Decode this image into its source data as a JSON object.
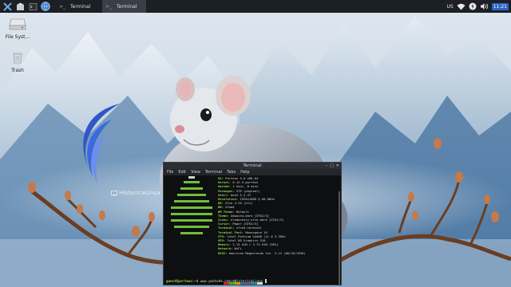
{
  "panel": {
    "tasks": [
      {
        "icon": "terminal-icon",
        "label": "Terminal"
      },
      {
        "icon": "terminal-icon",
        "label": "Terminal"
      }
    ],
    "tray": {
      "keyboard_layout": "US",
      "clock": "11:21"
    }
  },
  "desktop": {
    "icons": [
      {
        "label": "File Syst...",
        "icon": "drive-icon"
      },
      {
        "label": "Trash",
        "icon": "trash-icon"
      }
    ],
    "watermark": "HistoricaLinux"
  },
  "terminal": {
    "title": "Terminal",
    "menu": [
      "File",
      "Edit",
      "View",
      "Terminal",
      "Tabs",
      "Help"
    ],
    "info": [
      {
        "key": "OS:",
        "value": "Porteus 5.0 x86_64"
      },
      {
        "key": "Kernel:",
        "value": "6.12.5-porteus"
      },
      {
        "key": "Uptime:",
        "value": "1 hour, 8 mins"
      },
      {
        "key": "Packages:",
        "value": "576 (pkgtool)"
      },
      {
        "key": "Shell:",
        "value": "bash 5.2.37"
      },
      {
        "key": "Resolution:",
        "value": "1920x1080 @ 60.00Hz"
      },
      {
        "key": "DE:",
        "value": "Xfce 4.20 (x11)"
      },
      {
        "key": "WM:",
        "value": "Xfwm4"
      },
      {
        "key": "WM Theme:",
        "value": "Default"
      },
      {
        "key": "Theme:",
        "value": "Adwaita-dark [GTK2/3]"
      },
      {
        "key": "Icons:",
        "value": "elementary-xfce-dark [GTK2/3]"
      },
      {
        "key": "Cursor:",
        "value": "Paper [GTK2/3]"
      },
      {
        "key": "Terminal:",
        "value": "xfce4-terminal"
      },
      {
        "key": "Terminal Font:",
        "value": "Monospace 10"
      },
      {
        "key": "CPU:",
        "value": "Intel Pentium G4400 (2) @ 3.3GHz"
      },
      {
        "key": "GPU:",
        "value": "Intel HD Graphics 510"
      },
      {
        "key": "Memory:",
        "value": "2.13 GiB / 3.75 GiB (56%)"
      },
      {
        "key": "Network:",
        "value": "WiFi"
      },
      {
        "key": "BIOS:",
        "value": "American Megatrends Inc. 5.12 (06/26/2018)"
      }
    ],
    "prompt_user": "guest@porteus:~$",
    "prompt_text": "www.youtube.com/@HistoricaLinux"
  },
  "colors": {
    "panel_bg": "#1c1f24",
    "terminal_bg": "#0e0f11",
    "accent_green": "#8fd14f",
    "clock_bg": "#2a64c8"
  },
  "palette_top": [
    "#000000",
    "#cc2222",
    "#44aa22",
    "#c4a000",
    "#3465a4",
    "#75507b",
    "#06989a",
    "#d3d7cf"
  ],
  "palette_bottom": [
    "#555753",
    "#ef2929",
    "#8ae234",
    "#fce94f",
    "#729fcf",
    "#ad7fa8",
    "#34e2e2",
    "#eeeeec"
  ]
}
